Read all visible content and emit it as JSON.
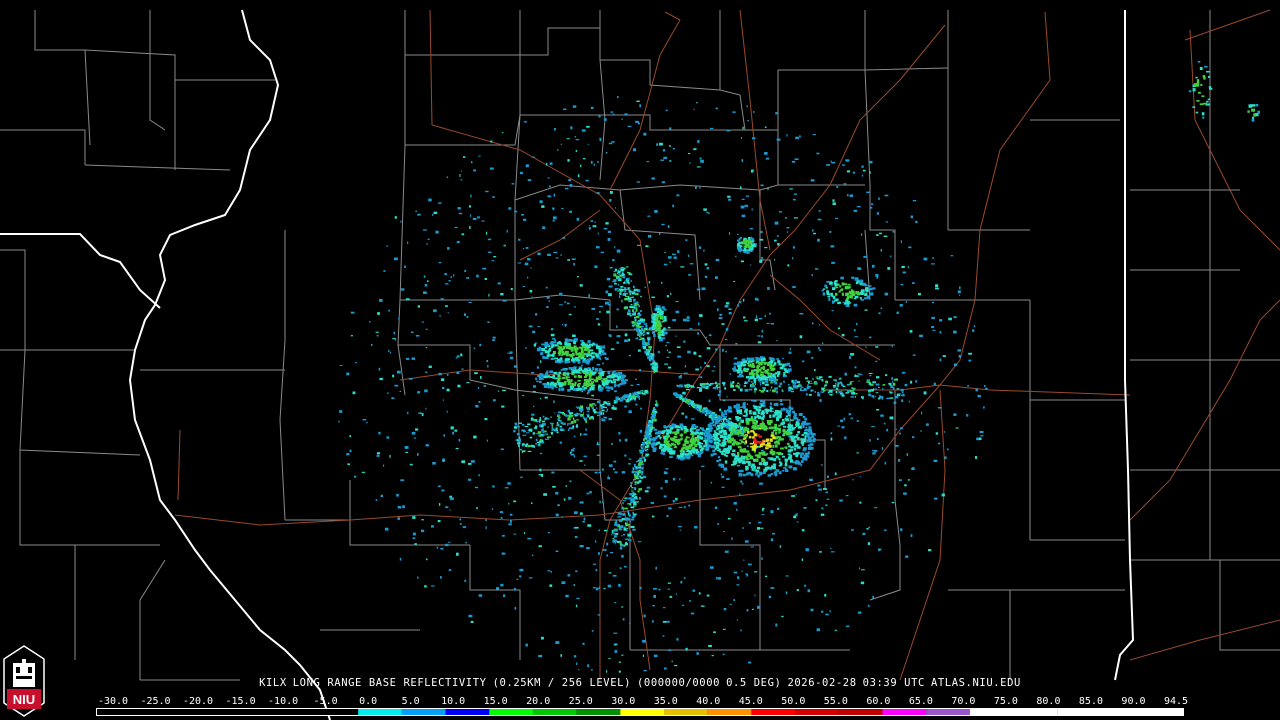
{
  "header": {
    "station": "KILX",
    "product": "LONG RANGE BASE REFLECTIVITY",
    "resolution": "(0.25KM / 256 LEVEL)",
    "volume": "(000000/0000",
    "elevation": "0.5 DEG)",
    "date": "2026-02-28",
    "time": "03:39 UTC",
    "source": "ATLAS.NIU.EDU"
  },
  "legend": {
    "scale_labels": [
      "-30.0",
      "-25.0",
      "-20.0",
      "-15.0",
      "-10.0",
      "-5.0",
      "0.0",
      "5.0",
      "10.0",
      "15.0",
      "20.0",
      "25.0",
      "30.0",
      "35.0",
      "40.0",
      "45.0",
      "50.0",
      "55.0",
      "60.0",
      "65.0",
      "70.0",
      "75.0",
      "80.0",
      "85.0",
      "90.0",
      "94.5"
    ],
    "colors": {
      "-30": "#000000",
      "0": "#00ecec",
      "5": "#01a0f6",
      "10": "#0000f6",
      "15": "#00ff00",
      "20": "#00c800",
      "25": "#009000",
      "30": "#ffff00",
      "35": "#e7c000",
      "40": "#ff9000",
      "45": "#ff0000",
      "50": "#d60000",
      "55": "#c00000",
      "60": "#ff00ff",
      "65": "#9955c9",
      "70": "#ffffff"
    }
  },
  "logo": {
    "text": "NIU",
    "colors": {
      "red": "#c8102e",
      "white": "#ffffff"
    }
  },
  "map_style": {
    "state_border": "#ffffff",
    "county_line": "#8a8a8a",
    "highway": "#9a4a2a",
    "echo_light": "#1a9ad0",
    "echo_mid": "#2be0c8",
    "echo_strong": "#40d040",
    "echo_core": "#e0e020",
    "echo_peak": "#e02020"
  }
}
